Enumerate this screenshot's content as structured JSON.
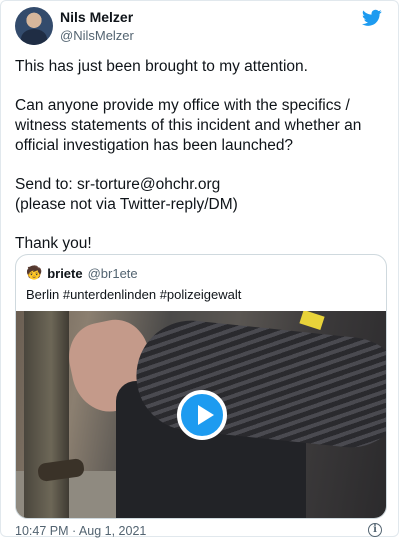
{
  "author": {
    "name": "Nils Melzer",
    "handle": "@NilsMelzer"
  },
  "tweet": {
    "paragraphs": [
      "This has just been brought to my attention.",
      "Can anyone provide my office with the specifics / witness statements of this incident and whether an official investigation has been launched?",
      "Send to: sr-torture@ohchr.org",
      "(please not via Twitter-reply/DM)",
      "Thank you!"
    ]
  },
  "quoted": {
    "avatar_icon": "child-emoji-icon",
    "name": "briete",
    "handle": "@br1ete",
    "text": "Berlin #unterdenlinden #polizeigewalt",
    "media": "video-thumbnail"
  },
  "footer": {
    "timestamp": "10:47 PM · Aug 1, 2021"
  },
  "colors": {
    "accent": "#1d9bf0",
    "muted": "#536471",
    "border": "#cfd9de"
  }
}
